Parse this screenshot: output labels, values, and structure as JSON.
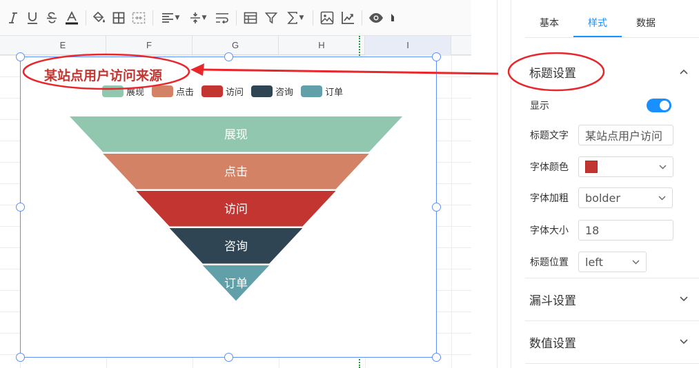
{
  "sheet": {
    "columns": [
      {
        "label": "E",
        "selected": false
      },
      {
        "label": "F",
        "selected": false
      },
      {
        "label": "G",
        "selected": false
      },
      {
        "label": "H",
        "selected": false
      },
      {
        "label": "I",
        "selected": true
      }
    ]
  },
  "toolbar": {
    "items": [
      "italic-icon",
      "underline-icon",
      "strikethrough-icon",
      "font-color-icon",
      "fill-color-icon",
      "borders-icon",
      "merge-cells-icon",
      "align-left-icon",
      "vertical-align-icon",
      "wrap-text-icon",
      "table-format-icon",
      "filter-icon",
      "sum-icon",
      "image-icon",
      "insert-chart-icon",
      "view-icon"
    ]
  },
  "chart": {
    "title": "某站点用户访问来源",
    "title_color": "#c23531"
  },
  "chart_data": {
    "type": "funnel",
    "title": "某站点用户访问来源",
    "legend_position": "top",
    "categories": [
      "展现",
      "点击",
      "访问",
      "咨询",
      "订单"
    ],
    "colors": [
      "#91c7ae",
      "#d48265",
      "#c23531",
      "#2f4554",
      "#61a0a8"
    ],
    "values": [
      100,
      80,
      60,
      40,
      20
    ]
  },
  "panel": {
    "tabs": [
      {
        "label": "基本",
        "active": false
      },
      {
        "label": "样式",
        "active": true
      },
      {
        "label": "数据",
        "active": false
      }
    ],
    "title_section": {
      "title": "标题设置",
      "expanded": true,
      "show_label": "显示",
      "show_value": true,
      "text_label": "标题文字",
      "text_value": "某站点用户访问",
      "color_label": "字体颜色",
      "color_value": "#c23531",
      "weight_label": "字体加粗",
      "weight_value": "bolder",
      "size_label": "字体大小",
      "size_value": "18",
      "position_label": "标题位置",
      "position_value": "left"
    },
    "funnel_section": {
      "title": "漏斗设置",
      "expanded": false
    },
    "value_section": {
      "title": "数值设置",
      "expanded": false
    }
  },
  "annotation": {
    "color": "#e8262b"
  }
}
